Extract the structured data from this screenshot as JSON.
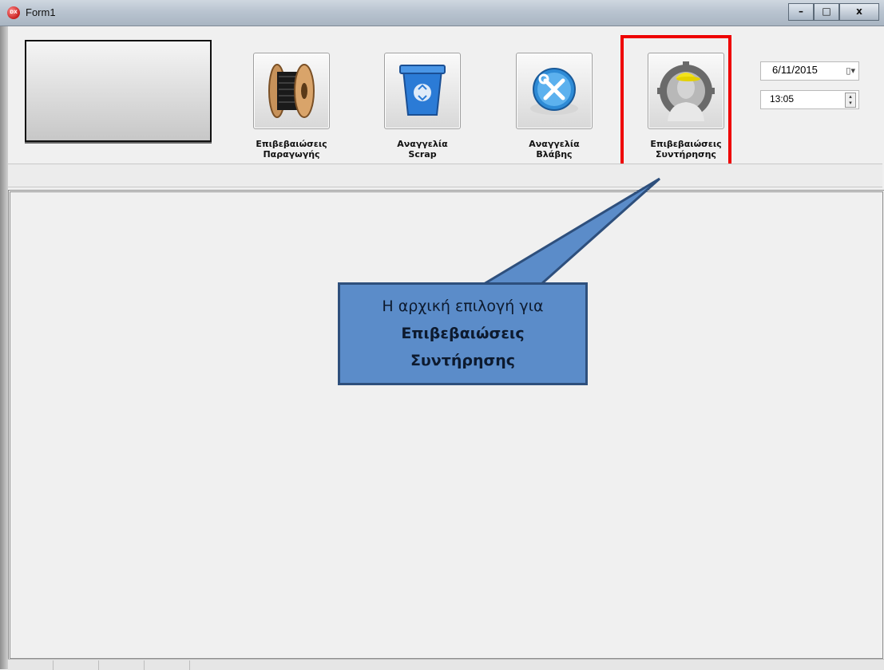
{
  "window": {
    "title": "Form1",
    "app_icon_text": "DX",
    "min": "–",
    "max": "□",
    "close": "x"
  },
  "toolbar": {
    "tools": [
      {
        "label_line1": "Επιβεβαιώσεις",
        "label_line2": "Παραγωγής",
        "icon": "cable-reel-icon"
      },
      {
        "label_line1": "Αναγγελία",
        "label_line2": "Scrap",
        "icon": "recycle-bin-icon"
      },
      {
        "label_line1": "Αναγγελία",
        "label_line2": "Βλάβης",
        "icon": "repair-tools-icon"
      },
      {
        "label_line1": "Επιβεβαιώσεις",
        "label_line2": "Συντήρησης",
        "icon": "maintenance-worker-icon"
      }
    ],
    "date_value": "6/11/2015",
    "time_value": "13:05"
  },
  "callout": {
    "line1": "Η αρχική επιλογή για",
    "line2": "Επιβεβαιώσεις",
    "line3": "Συντήρησης"
  },
  "colors": {
    "highlight": "#ee0000",
    "callout_fill": "#5b8cc9",
    "callout_border": "#2e4f7c"
  }
}
